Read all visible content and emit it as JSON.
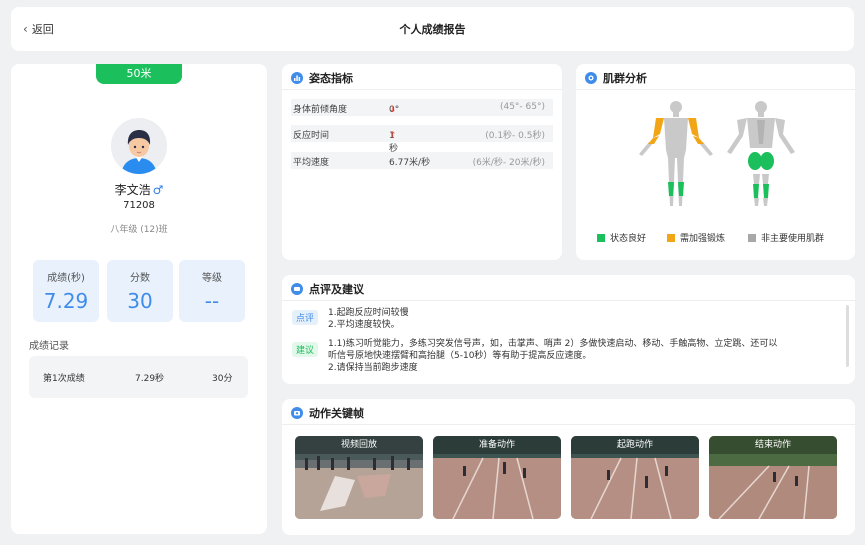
{
  "header": {
    "back_label": "返回",
    "title": "个人成绩报告"
  },
  "profile": {
    "distance": "50米",
    "name": "李文浩",
    "gender_symbol": "♂",
    "student_id": "71208",
    "class_name": "八年级 (12)班",
    "stats": [
      {
        "label": "成绩(秒)",
        "value": "7.29"
      },
      {
        "label": "分数",
        "value": "30"
      },
      {
        "label": "等级",
        "value": "--"
      }
    ],
    "records_title": "成绩记录",
    "records": [
      {
        "attempt": "第1次成绩",
        "time": "7.29秒",
        "score": "30分"
      }
    ]
  },
  "posture": {
    "title": "姿态指标",
    "metrics": [
      {
        "label": "身体前倾角度",
        "value": "0°",
        "trend": "↓",
        "range": "(45°- 65°)"
      },
      {
        "label": "反应时间",
        "value": "1秒",
        "trend": "↑",
        "range": "(0.1秒- 0.5秒)"
      },
      {
        "label": "平均速度",
        "value": "6.77米/秒",
        "trend": "",
        "range": "(6米/秒- 20米/秒)"
      }
    ]
  },
  "muscle": {
    "title": "肌群分析",
    "legend": [
      {
        "label": "状态良好",
        "color": "#1bbf5c"
      },
      {
        "label": "需加强锻炼",
        "color": "#f2a516"
      },
      {
        "label": "非主要使用肌群",
        "color": "#a8a8a8"
      }
    ]
  },
  "comment": {
    "title": "点评及建议",
    "review_tag": "点评",
    "review_lines": [
      "1.起跑反应时间较慢",
      "2.平均速度较快。"
    ],
    "advice_tag": "建议",
    "advice_lines": [
      "1.1)练习听觉能力，多练习突发信号声，如，击掌声、哨声 2）多做快速启动、移动、手触高物、立定跳、还可以",
      "听信号原地快速摆臂和高抬腿（5-10秒）等有助于提高反应速度。",
      "2.请保持当前跑步速度"
    ]
  },
  "frames": {
    "title": "动作关键帧",
    "items": [
      "视频回放",
      "准备动作",
      "起跑动作",
      "结束动作"
    ]
  },
  "colors": {
    "accent": "#3f8de8",
    "green": "#1bbf5c",
    "orange": "#f2a516",
    "grey": "#a8a8a8"
  }
}
